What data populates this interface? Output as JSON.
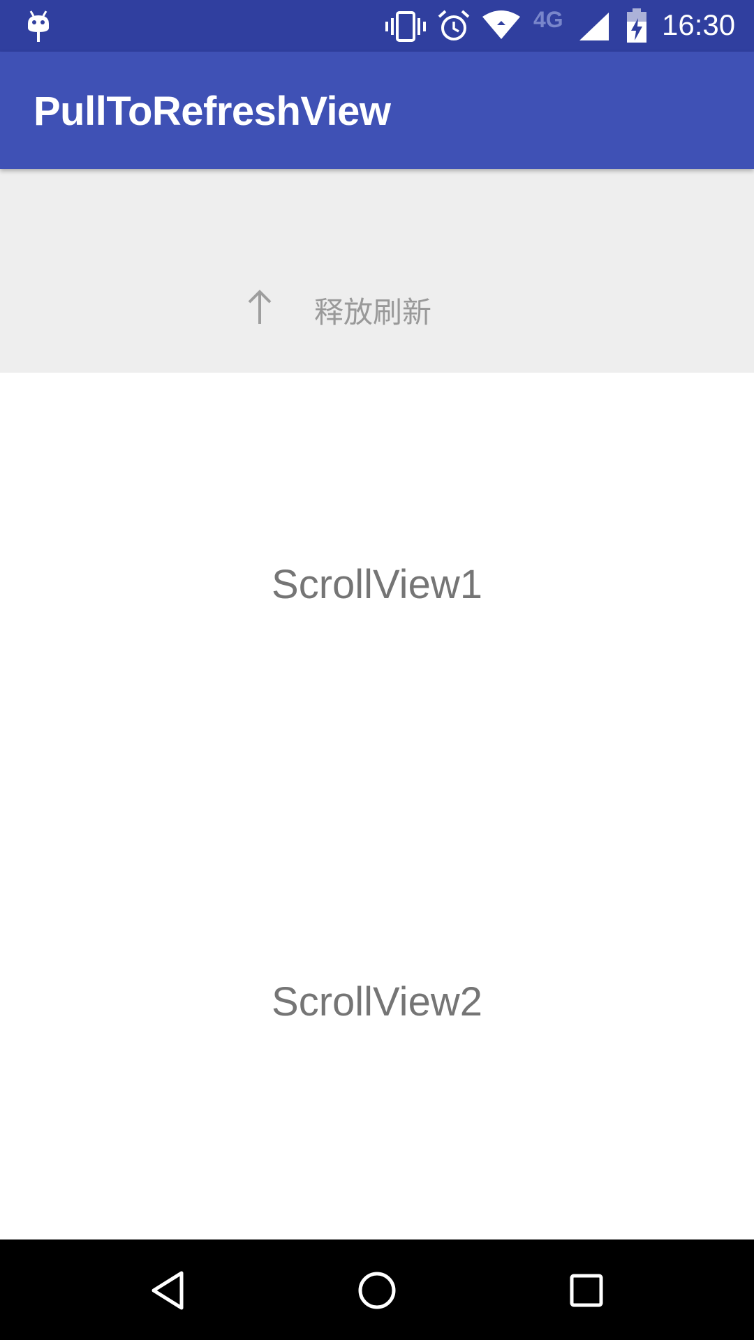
{
  "status_bar": {
    "network_type": "4G",
    "time": "16:30",
    "icons": [
      "debug-icon",
      "vibrate-icon",
      "alarm-icon",
      "wifi-icon",
      "signal-icon",
      "battery-charging-icon"
    ]
  },
  "app_bar": {
    "title": "PullToRefreshView"
  },
  "refresh_header": {
    "icon": "arrow-up-icon",
    "label": "释放刷新"
  },
  "content": {
    "items": [
      {
        "label": "ScrollView1"
      },
      {
        "label": "ScrollView2"
      }
    ]
  },
  "nav_bar": {
    "buttons": [
      "back-icon",
      "home-icon",
      "recents-icon"
    ]
  },
  "colors": {
    "status_bar": "#303f9f",
    "app_bar": "#3f51b5",
    "header_bg": "#eeeeee",
    "text_gray": "#757575"
  }
}
